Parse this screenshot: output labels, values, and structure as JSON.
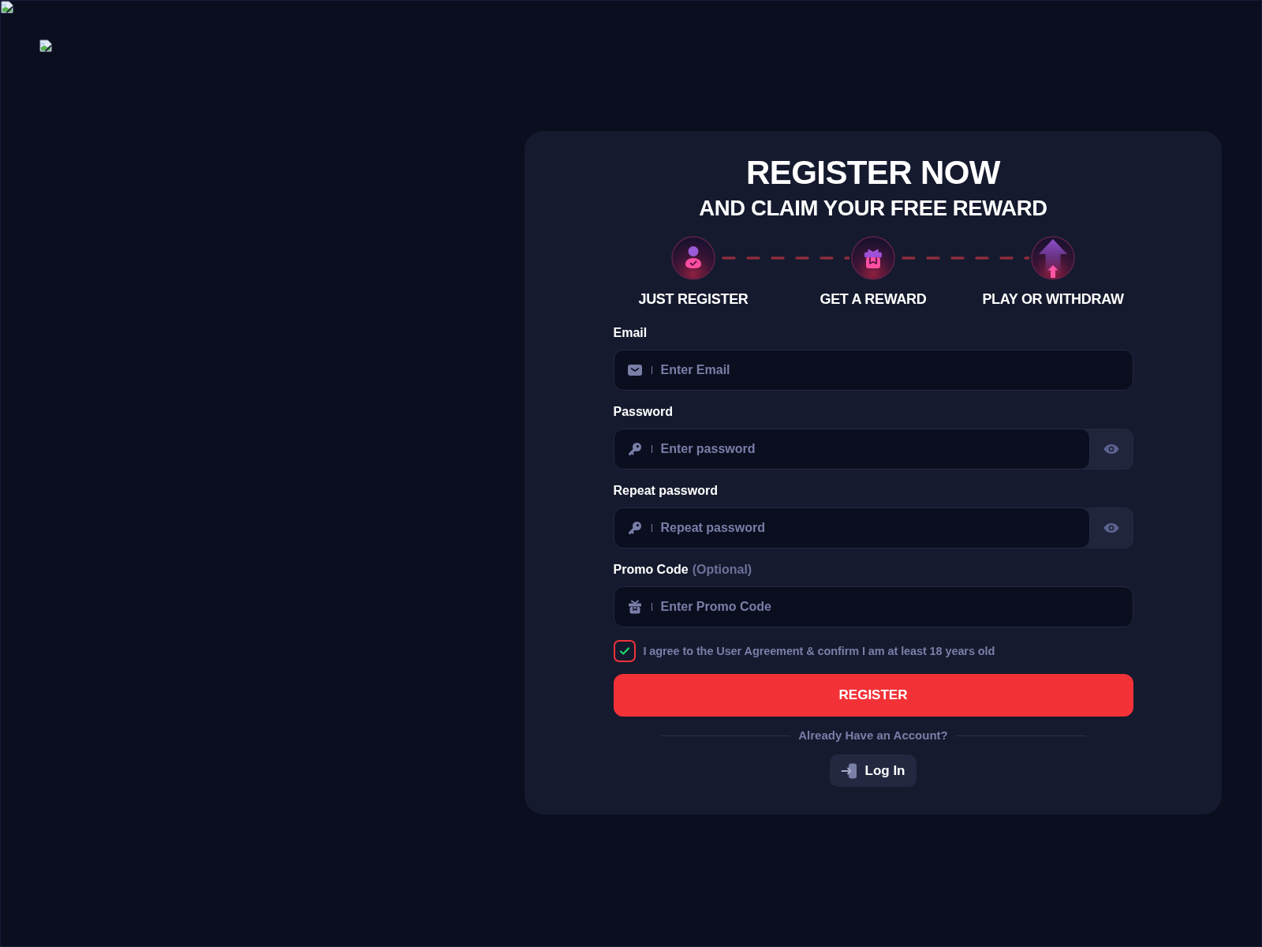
{
  "heading": {
    "title": "REGISTER NOW",
    "subtitle": "AND CLAIM YOUR FREE REWARD"
  },
  "steps": [
    {
      "kind": "user",
      "label": "JUST REGISTER"
    },
    {
      "kind": "gift",
      "label": "GET A REWARD"
    },
    {
      "kind": "arrow",
      "label": "PLAY OR WITHDRAW"
    }
  ],
  "fields": [
    {
      "kind": "email",
      "label": "Email",
      "placeholder": "Enter Email"
    },
    {
      "kind": "password",
      "label": "Password",
      "placeholder": "Enter password"
    },
    {
      "kind": "password",
      "label": "Repeat password",
      "placeholder": "Repeat password"
    },
    {
      "kind": "promo",
      "label": "Promo Code",
      "note": "(Optional)",
      "placeholder": "Enter Promo Code"
    }
  ],
  "agreement": {
    "text": "I agree to the User Agreement & confirm I am at least 18 years old",
    "checked": true
  },
  "register_button": "REGISTER",
  "login_prompt": "Already Have an Account?",
  "login_button": "Log In"
}
